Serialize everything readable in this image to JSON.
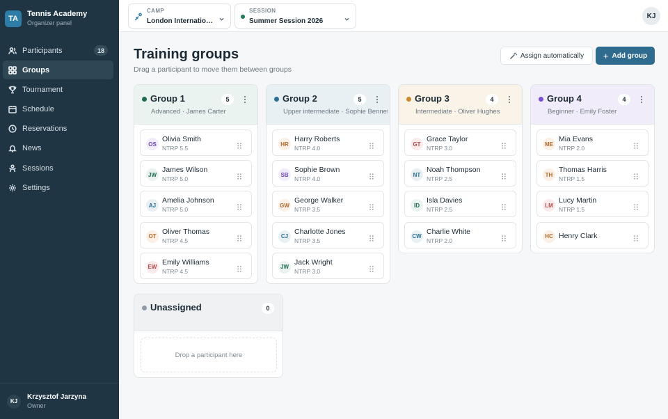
{
  "brand": {
    "logo": "TA",
    "title": "Tennis Academy",
    "subtitle": "Organizer panel"
  },
  "nav": [
    {
      "label": "Participants",
      "icon": "users-icon",
      "badge": "18",
      "active": false
    },
    {
      "label": "Groups",
      "icon": "grid-icon",
      "active": true
    },
    {
      "label": "Tournament",
      "icon": "trophy-icon",
      "active": false
    },
    {
      "label": "Schedule",
      "icon": "calendar-icon",
      "active": false
    },
    {
      "label": "Reservations",
      "icon": "clock-icon",
      "active": false
    },
    {
      "label": "News",
      "icon": "bell-icon",
      "active": false
    },
    {
      "label": "Sessions",
      "icon": "sessions-icon",
      "active": false
    },
    {
      "label": "Settings",
      "icon": "gear-icon",
      "active": false
    }
  ],
  "user": {
    "initials": "KJ",
    "name": "Krzysztof Jarzyna",
    "role": "Owner"
  },
  "topbar": {
    "camp": {
      "label": "CAMP",
      "value": "London International..."
    },
    "session": {
      "label": "SESSION",
      "value": "Summer Session 2026"
    },
    "avatar": "KJ"
  },
  "page": {
    "title": "Training groups",
    "subtitle": "Drag a participant to move them between groups",
    "assign_label": "Assign automatically",
    "add_label": "Add group"
  },
  "groups": [
    {
      "name": "Group 1",
      "count": "5",
      "meta": "Advanced · James Carter",
      "color": "#1f6b4f",
      "head_bg": "#eaf3ef",
      "participants": [
        {
          "initials": "OS",
          "name": "Olivia Smith",
          "ntrp": "NTRP 5.5"
        },
        {
          "initials": "JW",
          "name": "James Wilson",
          "ntrp": "NTRP 5.0"
        },
        {
          "initials": "AJ",
          "name": "Amelia Johnson",
          "ntrp": "NTRP 5.0"
        },
        {
          "initials": "OT",
          "name": "Oliver Thomas",
          "ntrp": "NTRP 4.5"
        },
        {
          "initials": "EW",
          "name": "Emily Williams",
          "ntrp": "NTRP 4.5"
        }
      ]
    },
    {
      "name": "Group 2",
      "count": "5",
      "meta": "Upper intermediate · Sophie Bennett",
      "color": "#2a6f93",
      "head_bg": "#e8f0f4",
      "participants": [
        {
          "initials": "HR",
          "name": "Harry Roberts",
          "ntrp": "NTRP 4.0"
        },
        {
          "initials": "SB",
          "name": "Sophie Brown",
          "ntrp": "NTRP 4.0"
        },
        {
          "initials": "GW",
          "name": "George Walker",
          "ntrp": "NTRP 3.5"
        },
        {
          "initials": "CJ",
          "name": "Charlotte Jones",
          "ntrp": "NTRP 3.5"
        },
        {
          "initials": "JW",
          "name": "Jack Wright",
          "ntrp": "NTRP 3.0"
        }
      ]
    },
    {
      "name": "Group 3",
      "count": "4",
      "meta": "Intermediate · Oliver Hughes",
      "color": "#c88a2c",
      "head_bg": "#faf3e8",
      "participants": [
        {
          "initials": "GT",
          "name": "Grace Taylor",
          "ntrp": "NTRP 3.0"
        },
        {
          "initials": "NT",
          "name": "Noah Thompson",
          "ntrp": "NTRP 2.5"
        },
        {
          "initials": "ID",
          "name": "Isla Davies",
          "ntrp": "NTRP 2.5"
        },
        {
          "initials": "CW",
          "name": "Charlie White",
          "ntrp": "NTRP 2.0"
        }
      ]
    },
    {
      "name": "Group 4",
      "count": "4",
      "meta": "Beginner · Emily Foster",
      "color": "#7b4fd6",
      "head_bg": "#f1ecfa",
      "participants": [
        {
          "initials": "ME",
          "name": "Mia Evans",
          "ntrp": "NTRP 2.0"
        },
        {
          "initials": "TH",
          "name": "Thomas Harris",
          "ntrp": "NTRP 1.5"
        },
        {
          "initials": "LM",
          "name": "Lucy Martin",
          "ntrp": "NTRP 1.5"
        },
        {
          "initials": "HC",
          "name": "Henry Clark",
          "ntrp": ""
        }
      ]
    }
  ],
  "unassigned": {
    "name": "Unassigned",
    "count": "0",
    "drop_text": "Drop a participant here"
  }
}
